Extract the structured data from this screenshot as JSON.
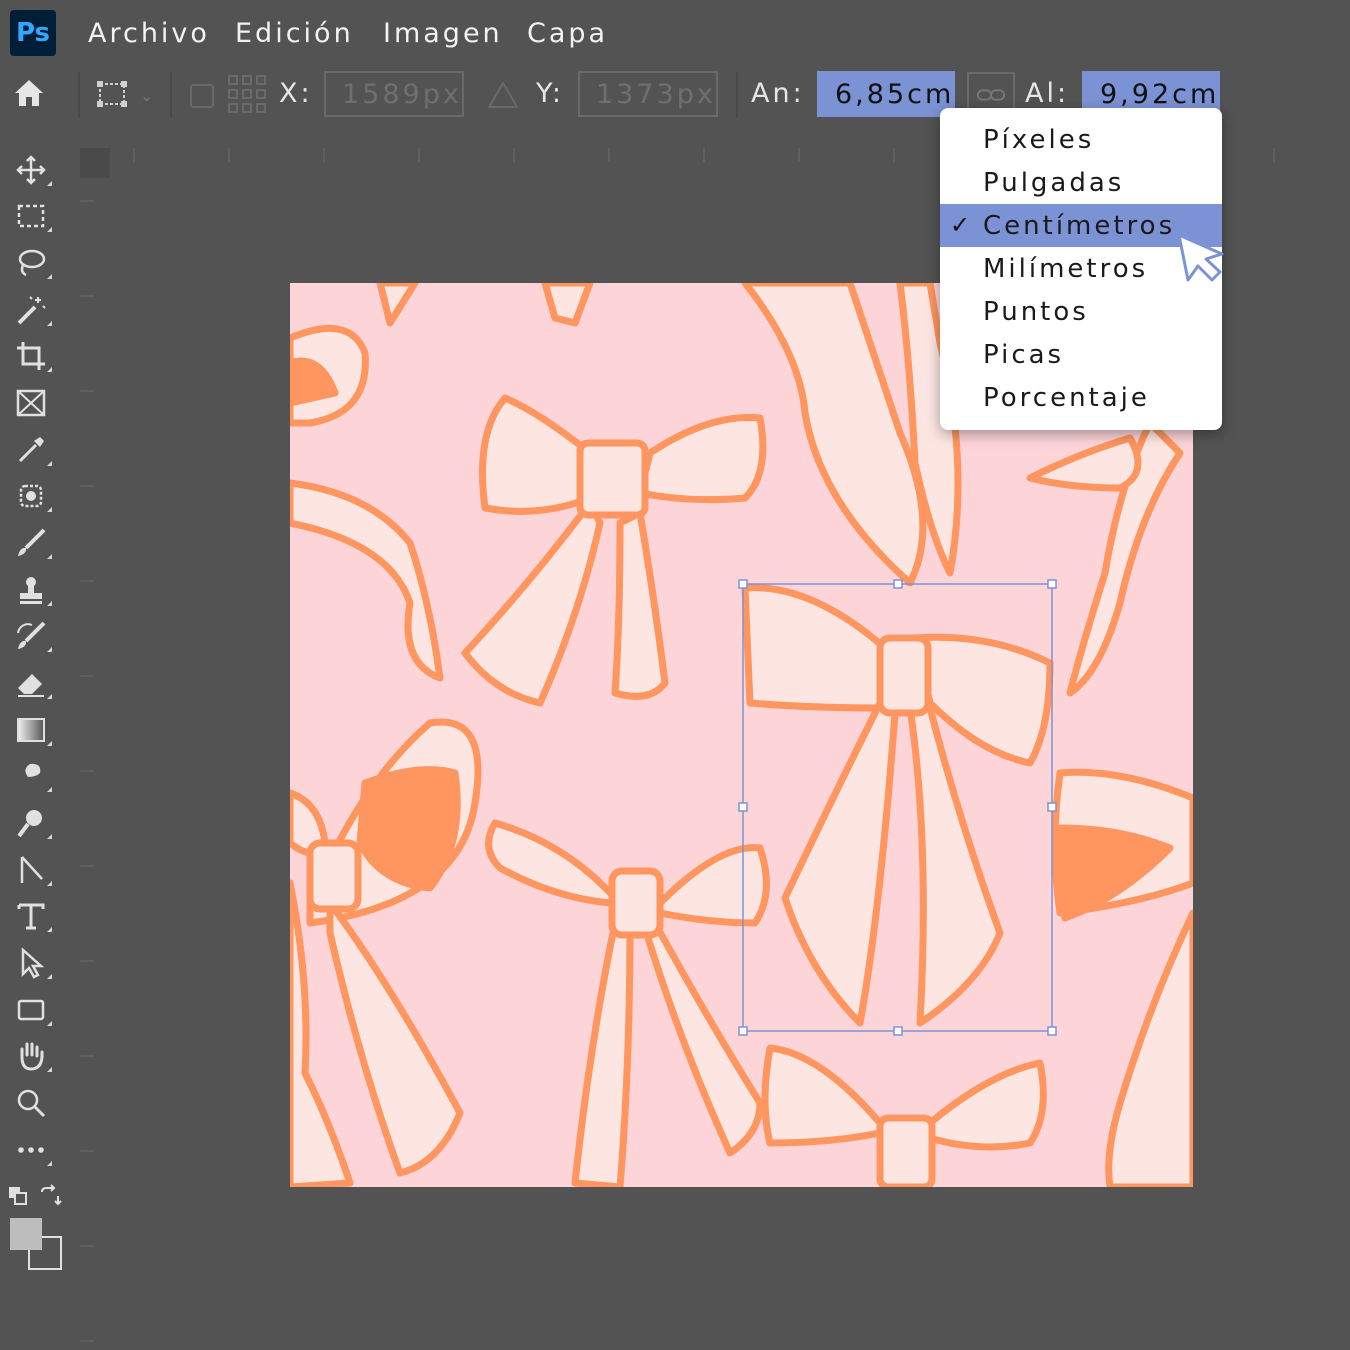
{
  "app": {
    "logo_text": "Ps",
    "accent": "#7b93d4",
    "logo_color": "#31a8ff"
  },
  "menu": [
    "Archivo",
    "Edición",
    "Imagen",
    "Capa"
  ],
  "options_bar": {
    "x_label": "X:",
    "x_value": "1589px",
    "y_label": "Y:",
    "y_value": "1373px",
    "w_label": "An:",
    "w_value": "6,85cm",
    "h_label": "Al:",
    "h_value": "9,92cm"
  },
  "tools": [
    "home-icon",
    "transform-icon",
    "move-icon",
    "marquee-icon",
    "lasso-icon",
    "magic-wand-icon",
    "crop-icon",
    "frame-icon",
    "eyedropper-icon",
    "spot-heal-icon",
    "brush-icon",
    "stamp-icon",
    "history-brush-icon",
    "eraser-icon",
    "gradient-icon",
    "smudge-icon",
    "dodge-icon",
    "path-select-icon",
    "type-icon",
    "direct-select-icon",
    "rectangle-icon",
    "hand-icon",
    "zoom-icon",
    "more-icon",
    "swap-colors-icon",
    "color-swatches-icon"
  ],
  "unit_menu": {
    "items": [
      "Píxeles",
      "Pulgadas",
      "Centímetros",
      "Milímetros",
      "Puntos",
      "Picas",
      "Porcentaje"
    ],
    "selected": "Centímetros"
  },
  "canvas": {
    "background": "#fdd5d9",
    "ribbon_fill": "#fde6e2",
    "ribbon_stroke": "#ff955f"
  }
}
